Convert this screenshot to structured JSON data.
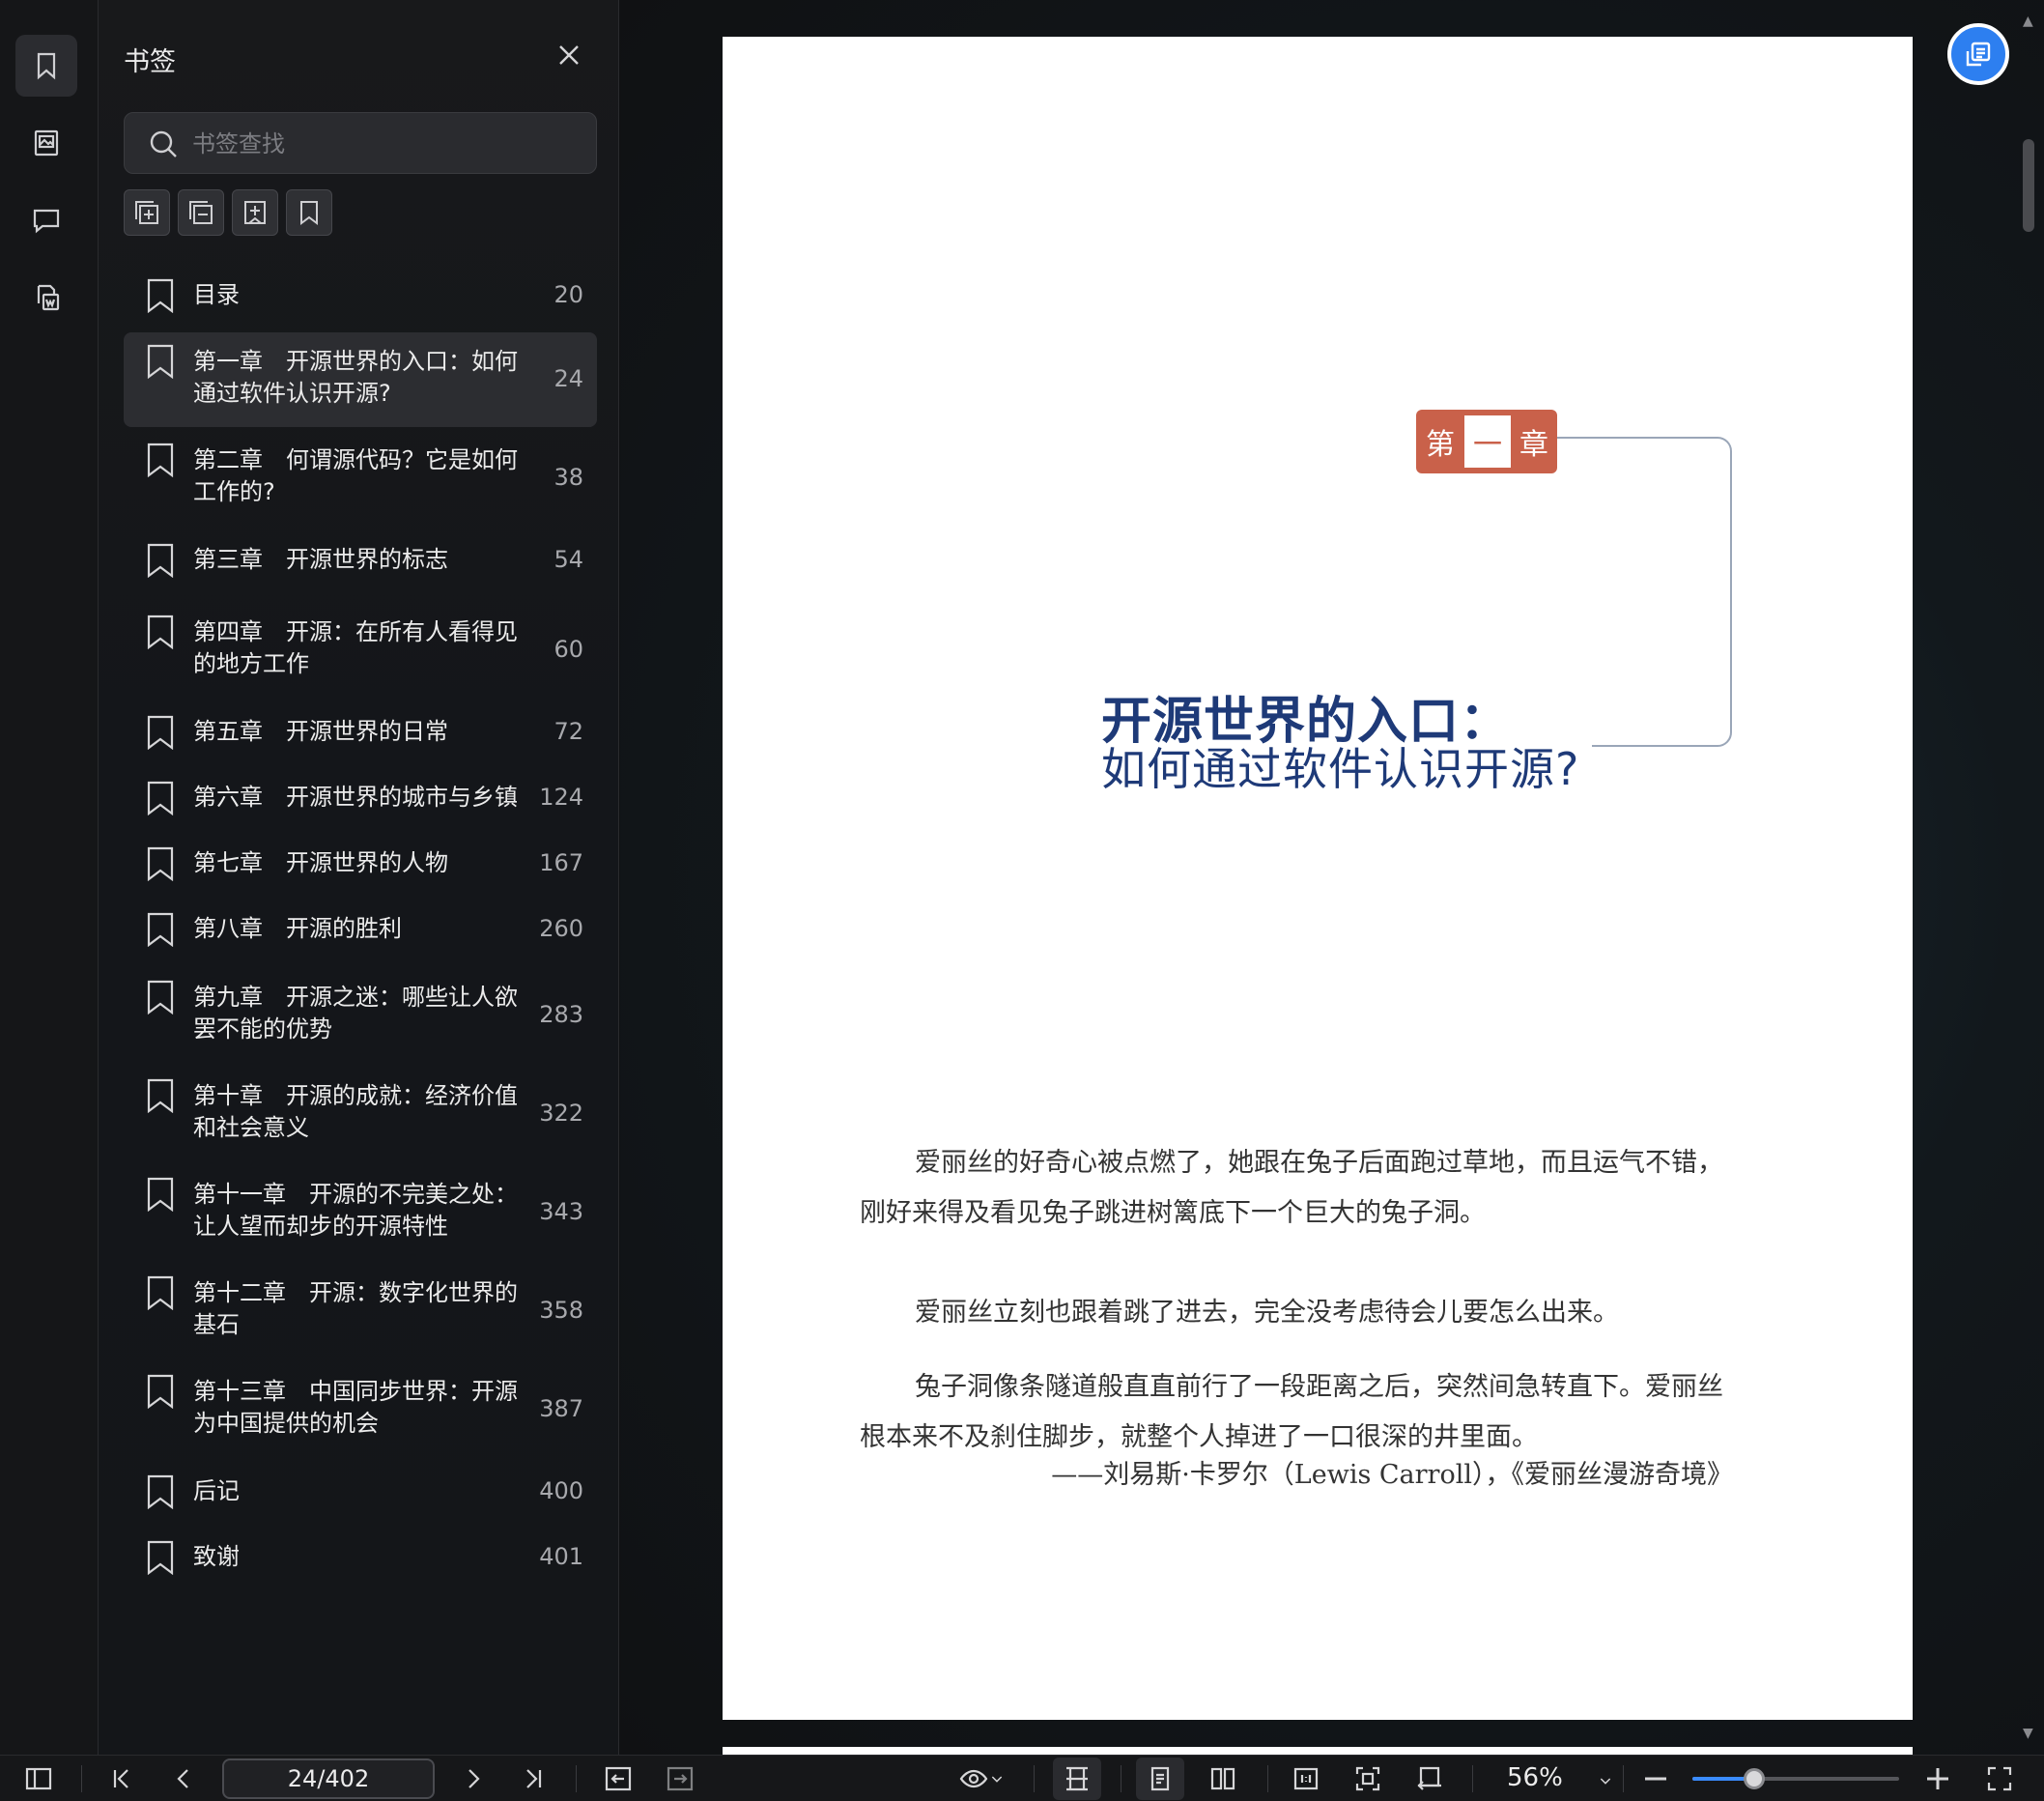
{
  "sidebar_panel": {
    "title": "书签",
    "search_placeholder": "书签查找",
    "bookmarks": [
      {
        "label": "目录",
        "page": "20"
      },
      {
        "label": "第一章　开源世界的入口：如何通过软件认识开源?",
        "page": "24",
        "selected": true
      },
      {
        "label": "第二章　何谓源代码？它是如何工作的?",
        "page": "38"
      },
      {
        "label": "第三章　开源世界的标志",
        "page": "54"
      },
      {
        "label": "第四章　开源：在所有人看得见的地方工作",
        "page": "60"
      },
      {
        "label": "第五章　开源世界的日常",
        "page": "72"
      },
      {
        "label": "第六章　开源世界的城市与乡镇",
        "page": "124"
      },
      {
        "label": "第七章　开源世界的人物",
        "page": "167"
      },
      {
        "label": "第八章　开源的胜利",
        "page": "260"
      },
      {
        "label": "第九章　开源之迷：哪些让人欲罢不能的优势",
        "page": "283"
      },
      {
        "label": "第十章　开源的成就：经济价值和社会意义",
        "page": "322"
      },
      {
        "label": "第十一章　开源的不完美之处：让人望而却步的开源特性",
        "page": "343"
      },
      {
        "label": "第十二章　开源：数字化世界的基石",
        "page": "358"
      },
      {
        "label": "第十三章　中国同步世界：开源为中国提供的机会",
        "page": "387"
      },
      {
        "label": "后记",
        "page": "400"
      },
      {
        "label": "致谢",
        "page": "401"
      }
    ]
  },
  "document": {
    "chapter_badge": [
      "第",
      "一",
      "章"
    ],
    "title_line1": "开源世界的入口：",
    "title_line2": "如何通过软件认识开源?",
    "paragraphs": [
      "爱丽丝的好奇心被点燃了，她跟在兔子后面跑过草地，而且运气不错，刚好来得及看见兔子跳进树篱底下一个巨大的兔子洞。",
      "爱丽丝立刻也跟着跳了进去，完全没考虑待会儿要怎么出来。",
      "兔子洞像条隧道般直直前行了一段距离之后，突然间急转直下。爱丽丝根本来不及刹住脚步，就整个人掉进了一口很深的井里面。"
    ],
    "quote": "——刘易斯·卡罗尔（Lewis Carroll），《爱丽丝漫游奇境》"
  },
  "toolbar": {
    "page_indicator": "24/402",
    "zoom_label": "56%",
    "zoom_fraction": 0.3
  },
  "colors": {
    "accent_blue": "#2d7ff0",
    "chapter_red": "#c9614a",
    "title_navy": "#1e3a78"
  }
}
